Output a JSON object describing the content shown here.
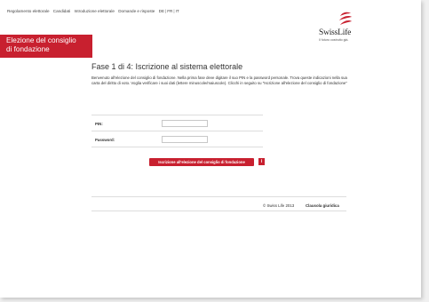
{
  "topnav": {
    "items": [
      "Regolamento elettorale",
      "Candidati",
      "Introduzione elettorale",
      "Domande e risposte"
    ],
    "languages": [
      "DE",
      "FR",
      "IT"
    ]
  },
  "logo": {
    "name": "SwissLife",
    "tagline": "Il futuro costruito già."
  },
  "section": {
    "title_line1": "Elezione del consiglio",
    "title_line2": "di fondazione"
  },
  "main": {
    "heading": "Fase 1 di 4: Iscrizione al sistema elettorale",
    "intro": "Benvenuto all'elezione del consiglio di fondazione. Nella prima fase deve digitare il suo PIN e la password personale. Trova queste indicazioni nella sua carta del diritto di voto. Voglia verificare i suoi dati (lettere minuscole/maiuscole). Clicchi in seguito su \"Iscrizione all'elezione del consiglio di fondazione\"",
    "pin_label": "PIN:",
    "pin_value": "",
    "password_label": "Password:",
    "password_value": "",
    "submit_label": "Iscrizione all'elezione del consiglio di fondazione",
    "info_label": "i"
  },
  "footer": {
    "copyright": "© Swiss Life 2013",
    "legal": "Clausola giuridica"
  },
  "colors": {
    "brand_red": "#c8202f"
  }
}
